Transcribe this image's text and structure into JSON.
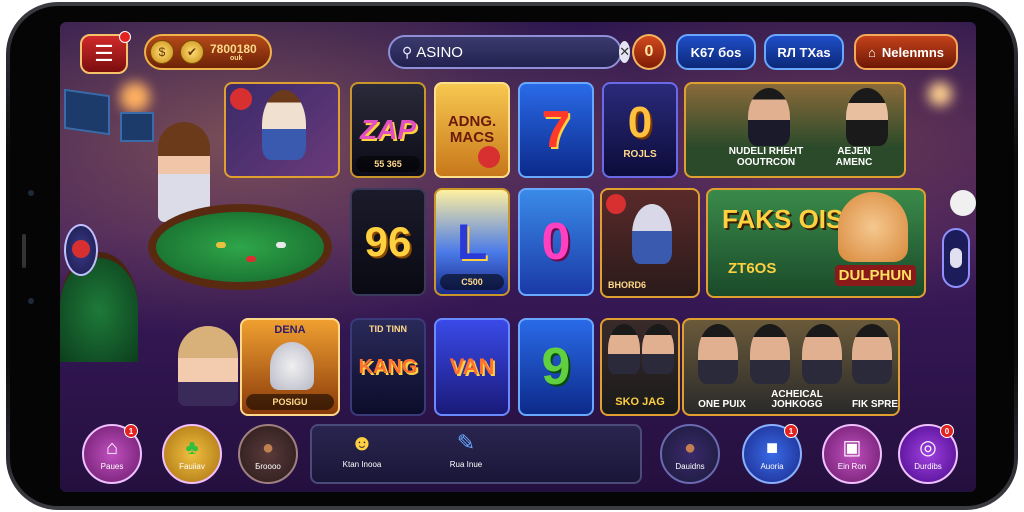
{
  "header": {
    "coins_main": "7800180",
    "coins_sub": "ouk",
    "search_value": "ASINO",
    "round_button": "0",
    "pill1": "K67 бos",
    "pill2": "RЛ TXas",
    "pill3": "Nelenmns"
  },
  "tiles": {
    "zap": "ZAP",
    "zap_label": "55 365",
    "adng": "ADNG. MACS",
    "seven": "7",
    "rolls_num": "0",
    "rolls_label": "ROJLS",
    "live_label": "NUDELI RHEHT OOUTRCON",
    "live_label2": "AEJEN AMENC",
    "n96": "96",
    "L": "L",
    "L_label": "C500",
    "zero": "0",
    "racer_label": "BHORD6",
    "faks": "FAKS OIS",
    "faks_sub": "ZT6OS",
    "dulphun": "DULPHUN",
    "dena": "DENA",
    "dena_label": "POSIGU",
    "kang_top": "TID TINN",
    "kang": "KANG",
    "van": "VAN",
    "nine": "9",
    "sko": "SKO JAG",
    "one": "ONE PUIX",
    "acheical": "ACHEICAL JOHKOGG",
    "fik": "FIK SPRE"
  },
  "nav": {
    "item1": "Paues",
    "item2": "Fauiiav",
    "item3": "Бroooo",
    "center1": "Ktan Inooa",
    "center2": "Rua Inue",
    "item4": "Dauidns",
    "item5": "Auoria",
    "item6": "Ein Ron",
    "item7": "Durdibs"
  },
  "badges": {
    "nav1": "1",
    "nav5": "1",
    "nav7": "0"
  },
  "colors": {
    "background": "#2a1550",
    "accent_gold": "#c9962a",
    "accent_red": "#d12a2a",
    "accent_blue": "#1f4ec8"
  }
}
